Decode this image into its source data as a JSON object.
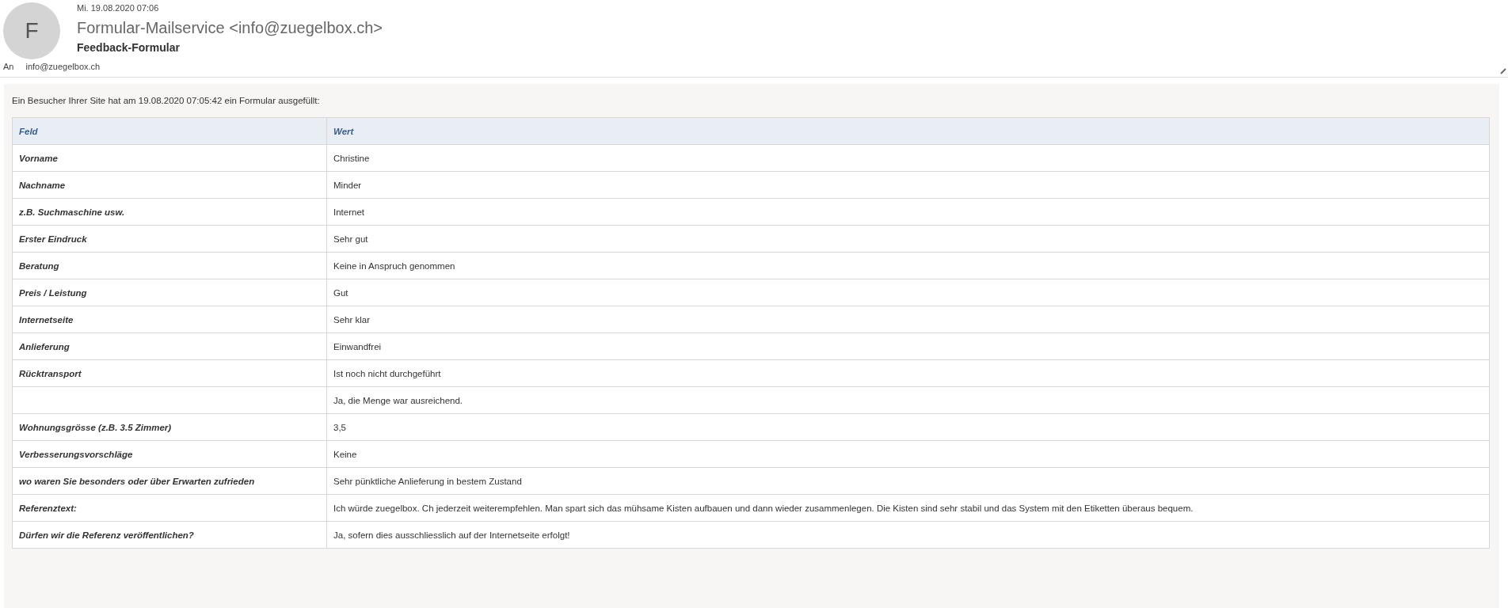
{
  "header": {
    "date": "Mi. 19.08.2020 07:06",
    "avatar_letter": "F",
    "sender": "Formular-Mailservice <info@zuegelbox.ch>",
    "subject": "Feedback-Formular",
    "to_label": "An",
    "to": "info@zuegelbox.ch"
  },
  "body": {
    "intro": "Ein Besucher Ihrer Site hat am 19.08.2020 07:05:42 ein Formular ausgefüllt:",
    "table": {
      "columns": [
        "Feld",
        "Wert"
      ],
      "rows": [
        {
          "field": "Vorname",
          "value": "Christine"
        },
        {
          "field": "Nachname",
          "value": "Minder"
        },
        {
          "field": "z.B. Suchmaschine usw.",
          "value": "Internet"
        },
        {
          "field": "Erster Eindruck",
          "value": "Sehr gut"
        },
        {
          "field": "Beratung",
          "value": "Keine in Anspruch genommen"
        },
        {
          "field": "Preis / Leistung",
          "value": "Gut"
        },
        {
          "field": "Internetseite",
          "value": "Sehr klar"
        },
        {
          "field": "Anlieferung",
          "value": "Einwandfrei"
        },
        {
          "field": "Rücktransport",
          "value": "Ist noch nicht durchgeführt"
        },
        {
          "field": "",
          "value": "Ja, die Menge war ausreichend."
        },
        {
          "field": "Wohnungsgrösse (z.B. 3.5 Zimmer)",
          "value": "3,5"
        },
        {
          "field": "Verbesserungsvorschläge",
          "value": "Keine"
        },
        {
          "field": "wo waren Sie besonders oder über Erwarten zufrieden",
          "value": "Sehr pünktliche Anlieferung in bestem Zustand"
        },
        {
          "field": "Referenztext:",
          "value": "Ich würde zuegelbox. Ch jederzeit weiterempfehlen. Man spart sich das mühsame Kisten aufbauen und dann wieder zusammenlegen. Die Kisten sind sehr stabil und das System mit den Etiketten überaus bequem."
        },
        {
          "field": "Dürfen wir die Referenz veröffentlichen?",
          "value": "Ja, sofern dies ausschliesslich auf der Internetseite erfolgt!"
        }
      ]
    }
  }
}
